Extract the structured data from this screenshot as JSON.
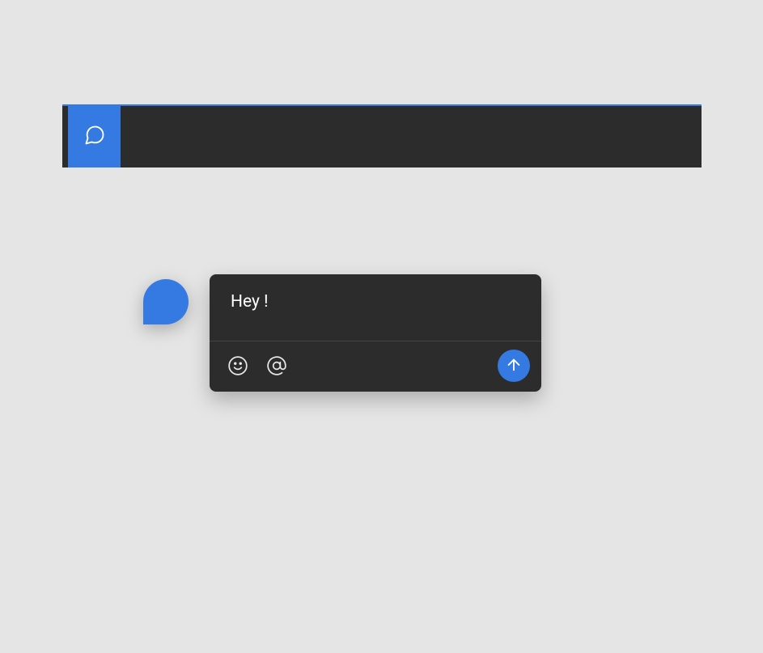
{
  "colors": {
    "accent": "#347ae2",
    "panel": "#2c2c2c",
    "background": "#e5e5e5"
  },
  "topbar": {
    "tabs": [
      {
        "icon": "chat-icon",
        "active": true
      }
    ]
  },
  "comment": {
    "text": "Hey !",
    "toolbar": {
      "emoji_icon": "emoji-icon",
      "mention_icon": "mention-icon",
      "send_icon": "send-icon"
    }
  }
}
